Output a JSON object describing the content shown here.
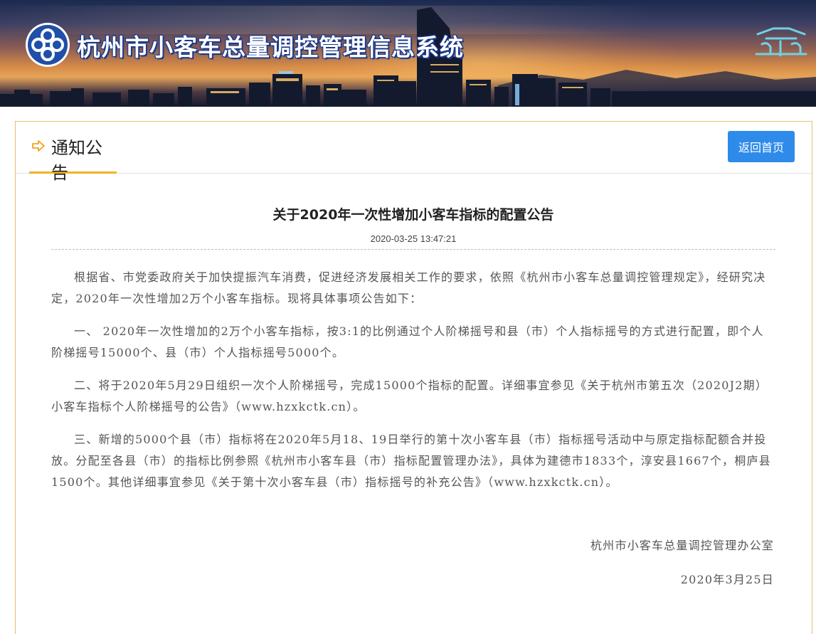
{
  "header": {
    "site_title": "杭州市小客车总量调控管理信息系统",
    "emblem_text": "亓"
  },
  "panel": {
    "section_title": "通知公告",
    "back_label": "返回首页"
  },
  "article": {
    "title": "关于2020年一次性增加小客车指标的配置公告",
    "date": "2020-03-25 13:47:21",
    "paragraphs": [
      "根据省、市党委政府关于加快提振汽车消费，促进经济发展相关工作的要求，依照《杭州市小客车总量调控管理规定》，经研究决定，2020年一次性增加2万个小客车指标。现将具体事项公告如下：",
      "一、 2020年一次性增加的2万个小客车指标，按3:1的比例通过个人阶梯摇号和县（市）个人指标摇号的方式进行配置，即个人阶梯摇号15000个、县（市）个人指标摇号5000个。",
      "二、将于2020年5月29日组织一次个人阶梯摇号，完成15000个指标的配置。详细事宜参见《关于杭州市第五次（2020J2期）小客车指标个人阶梯摇号的公告》（www.hzxkctk.cn）。",
      "三、新增的5000个县（市）指标将在2020年5月18、19日举行的第十次小客车县（市）指标摇号活动中与原定指标配额合并投放。分配至各县（市）的指标比例参照《杭州市小客车县（市）指标配置管理办法》，具体为建德市1833个，淳安县1667个，桐庐县1500个。其他详细事宜参见《关于第十次小客车县（市）指标摇号的补充公告》（www.hzxkctk.cn）。"
    ],
    "signature_org": "杭州市小客车总量调控管理办公室",
    "signature_date": "2020年3月25日"
  },
  "colors": {
    "accent_yellow": "#f0b324",
    "button_blue": "#2e8bea",
    "panel_border": "#e3c06e"
  },
  "icons": {
    "logo": "knot-logo-icon",
    "section": "arrow-right-icon",
    "emblem": "city-emblem-icon"
  }
}
